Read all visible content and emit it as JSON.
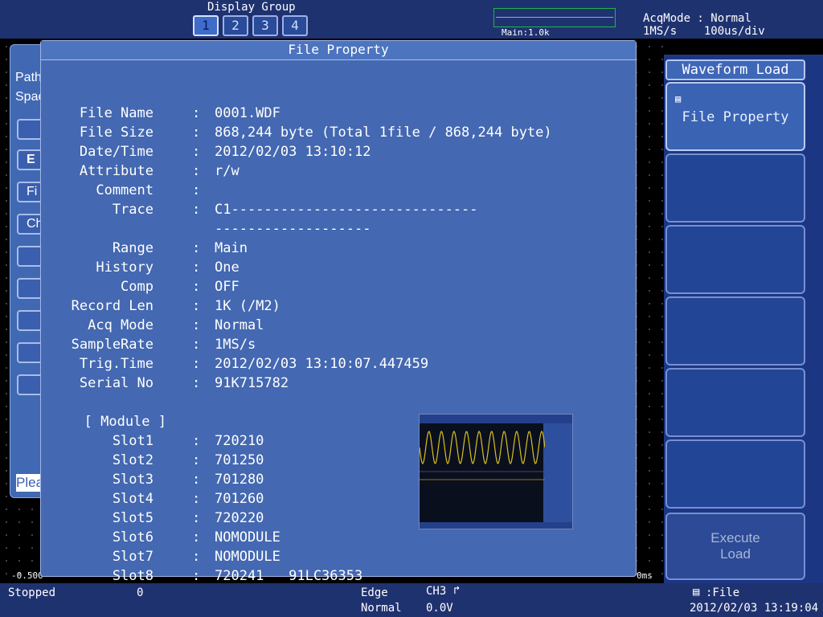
{
  "header": {
    "display_group_label": "Display Group",
    "display_groups": [
      "1",
      "2",
      "3",
      "4"
    ],
    "active_group": "1",
    "mini_label": "Main:1.0k",
    "acq_mode_line": "AcqMode : Normal",
    "acq_rate_line": "1MS/s    100us/div"
  },
  "left_panel": {
    "path_label": "Path",
    "space_label": "Spac",
    "btn_e": "E",
    "btn_fi": "Fi",
    "btn_ch": "Ch",
    "please_text": "Plea",
    "grid_left": "-0.500",
    "grid_right": "0ms"
  },
  "dialog": {
    "title": "File Property",
    "rows": [
      {
        "label": "File Name",
        "value": "0001.WDF"
      },
      {
        "label": "File Size",
        "value": "868,244 byte (Total 1file / 868,244 byte)"
      },
      {
        "label": "Date/Time",
        "value": "2012/02/03 13:10:12"
      },
      {
        "label": "Attribute",
        "value": "r/w"
      },
      {
        "label": "Comment",
        "value": ""
      },
      {
        "label": "Trace",
        "value": "C1------------------------------"
      },
      {
        "label": "",
        "value": "-------------------"
      },
      {
        "label": "Range",
        "value": "Main"
      },
      {
        "label": "History",
        "value": "One"
      },
      {
        "label": "Comp",
        "value": "OFF"
      },
      {
        "label": "Record Len",
        "value": "1K (/M2)"
      },
      {
        "label": "Acq Mode",
        "value": "Normal"
      },
      {
        "label": "SampleRate",
        "value": "1MS/s"
      },
      {
        "label": "Trig.Time",
        "value": "2012/02/03 13:10:07.447459"
      },
      {
        "label": "Serial No",
        "value": "91K715782"
      }
    ],
    "module_header": "[ Module ]",
    "slots": [
      {
        "label": "Slot1",
        "value": "720210"
      },
      {
        "label": "Slot2",
        "value": "701250"
      },
      {
        "label": "Slot3",
        "value": "701280"
      },
      {
        "label": "Slot4",
        "value": "701260"
      },
      {
        "label": "Slot5",
        "value": "720220"
      },
      {
        "label": "Slot6",
        "value": "NOMODULE"
      },
      {
        "label": "Slot7",
        "value": "NOMODULE"
      },
      {
        "label": "Slot8",
        "value": "720241   91LC36353"
      }
    ]
  },
  "menu": {
    "title": "Waveform Load",
    "file_property": "File Property",
    "execute_line1": "Execute",
    "execute_line2": "Load"
  },
  "status": {
    "state": "Stopped",
    "count": "0",
    "trigger_type": "Edge",
    "trigger_mode": "Normal",
    "trigger_source": "CH3",
    "trigger_level": "0.0V",
    "save_target": ":File",
    "datetime": "2012/02/03 13:19:04"
  },
  "colors": {
    "header_bg": "#1f3270",
    "dialog_bg": "#4468b1",
    "menu_bg": "#1b3784",
    "waveform": "#d8c020"
  }
}
